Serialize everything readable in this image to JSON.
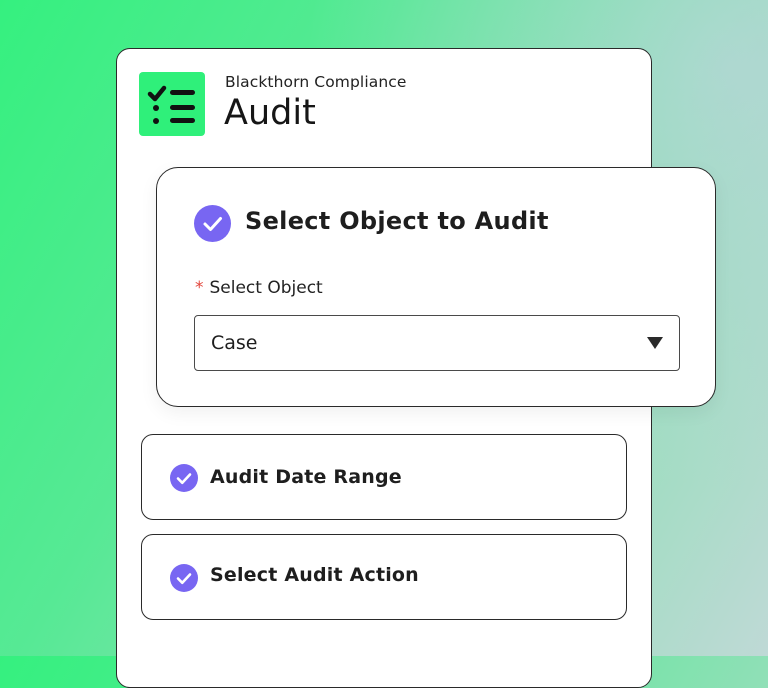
{
  "app": {
    "subtitle": "Blackthorn Compliance",
    "title": "Audit",
    "icon": "checklist-icon",
    "accent_color": "#2ff07a"
  },
  "select_object_card": {
    "title": "Select Object to Audit",
    "status_icon": "check-circle-icon",
    "field": {
      "required_marker": "*",
      "label": "Select Object",
      "value": "Case",
      "caret_icon": "caret-down-icon"
    }
  },
  "steps": [
    {
      "label": "Audit Date Range",
      "status_icon": "check-circle-icon"
    },
    {
      "label": "Select Audit Action",
      "status_icon": "check-circle-icon"
    }
  ],
  "colors": {
    "check": "#7866f2",
    "required": "#e2463c",
    "background_start": "#35f07f",
    "background_end": "#bfd9d6"
  }
}
